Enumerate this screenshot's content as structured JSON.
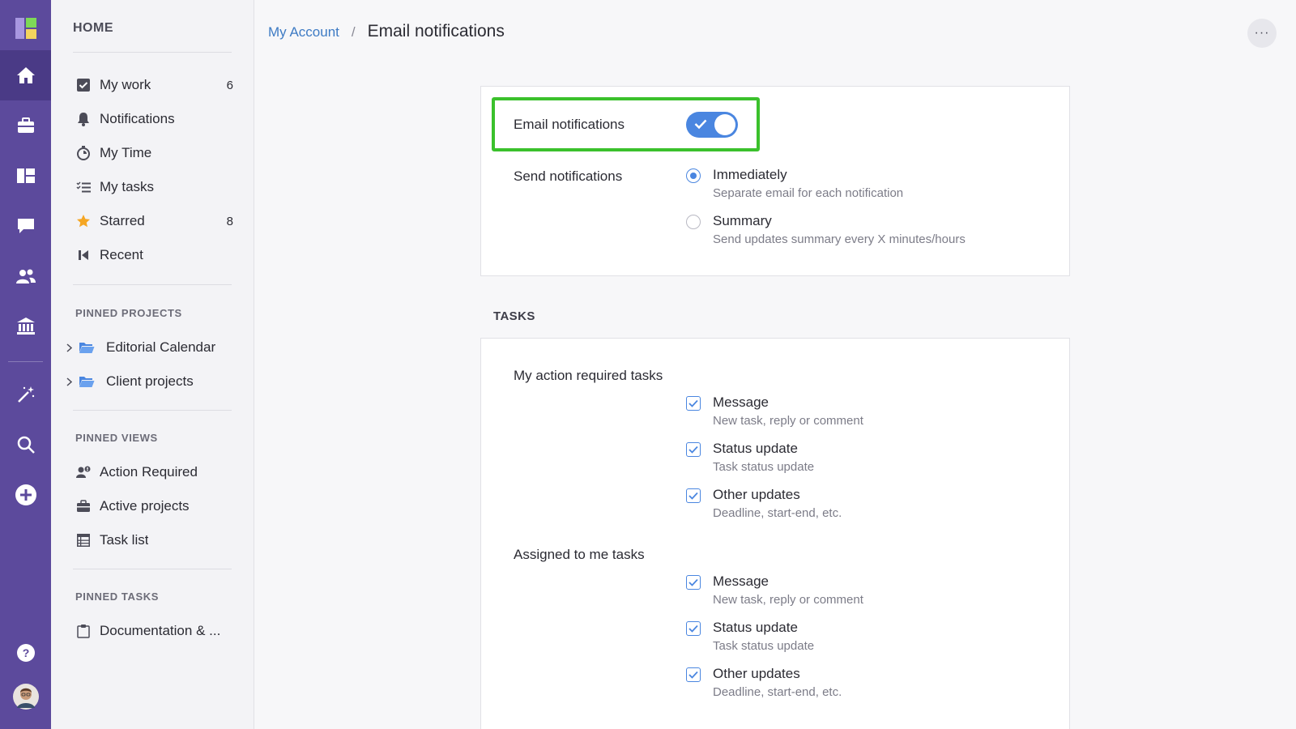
{
  "rail": {
    "items": [
      "logo-icon",
      "home-icon",
      "briefcase-icon",
      "board-icon",
      "chat-icon",
      "users-icon",
      "bank-icon",
      "wand-icon",
      "search-icon",
      "plus-circle-icon",
      "help-icon",
      "avatar"
    ]
  },
  "sidebar": {
    "title": "HOME",
    "items": [
      {
        "label": "My work",
        "count": "6",
        "icon": "checkbox-icon"
      },
      {
        "label": "Notifications",
        "count": "",
        "icon": "bell-icon"
      },
      {
        "label": "My Time",
        "count": "",
        "icon": "stopwatch-icon"
      },
      {
        "label": "My tasks",
        "count": "",
        "icon": "checklist-icon"
      },
      {
        "label": "Starred",
        "count": "8",
        "icon": "star-icon"
      },
      {
        "label": "Recent",
        "count": "",
        "icon": "rewind-icon"
      }
    ],
    "pinned_projects_title": "PINNED PROJECTS",
    "pinned_projects": [
      {
        "label": "Editorial Calendar",
        "icon": "folder-icon"
      },
      {
        "label": "Client projects",
        "icon": "folder-icon"
      }
    ],
    "pinned_views_title": "PINNED VIEWS",
    "pinned_views": [
      {
        "label": "Action Required",
        "icon": "user-alert-icon"
      },
      {
        "label": "Active projects",
        "icon": "briefcase-icon"
      },
      {
        "label": "Task list",
        "icon": "table-icon"
      }
    ],
    "pinned_tasks_title": "PINNED TASKS",
    "pinned_tasks": [
      {
        "label": "Documentation & ...",
        "icon": "clipboard-icon"
      }
    ]
  },
  "header": {
    "breadcrumb_link": "My Account",
    "breadcrumb_sep": "/",
    "title": "Email notifications",
    "more_label": "···"
  },
  "email": {
    "toggle_label": "Email notifications",
    "toggle_on": true,
    "send_label": "Send notifications",
    "options": [
      {
        "title": "Immediately",
        "sub": "Separate email for each notification",
        "selected": true
      },
      {
        "title": "Summary",
        "sub": "Send updates summary every X minutes/hours",
        "selected": false
      }
    ]
  },
  "tasks": {
    "section_title": "TASKS",
    "groups": [
      {
        "label": "My action required tasks",
        "options": [
          {
            "title": "Message",
            "sub": "New task, reply or comment",
            "checked": true
          },
          {
            "title": "Status update",
            "sub": "Task status update",
            "checked": true
          },
          {
            "title": "Other updates",
            "sub": "Deadline, start-end, etc.",
            "checked": true
          }
        ]
      },
      {
        "label": "Assigned to me tasks",
        "options": [
          {
            "title": "Message",
            "sub": "New task, reply or comment",
            "checked": true
          },
          {
            "title": "Status update",
            "sub": "Task status update",
            "checked": true
          },
          {
            "title": "Other updates",
            "sub": "Deadline, start-end, etc.",
            "checked": true
          }
        ]
      }
    ]
  },
  "colors": {
    "rail": "#5c4a9c",
    "accent": "#4a86e0",
    "highlight": "#3bc12c",
    "star": "#f5a623",
    "folder": "#4a86e0"
  }
}
